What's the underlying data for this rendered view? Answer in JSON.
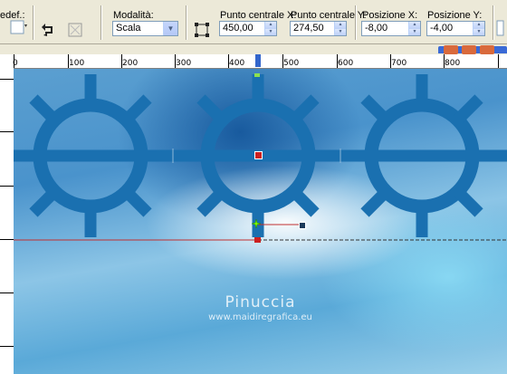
{
  "toolbar": {
    "preset_label": "edef.:",
    "mode_label": "Modalità:",
    "mode_value": "Scala",
    "center_x_label": "Punto centrale X:",
    "center_x_value": "450,00",
    "center_y_label": "Punto centrale Y:",
    "center_y_value": "274,50",
    "pos_x_label": "Posizione X:",
    "pos_x_value": "-8,00",
    "pos_y_label": "Posizione Y:",
    "pos_y_value": "-4,00"
  },
  "ruler": {
    "top_labels": [
      "0",
      "100",
      "200",
      "300",
      "400",
      "500",
      "600",
      "700",
      "800"
    ]
  },
  "canvas": {
    "watermark_title": "Pinuccia",
    "watermark_url": "www.maidiregrafica.eu",
    "shape_color": "#1a70b0"
  }
}
